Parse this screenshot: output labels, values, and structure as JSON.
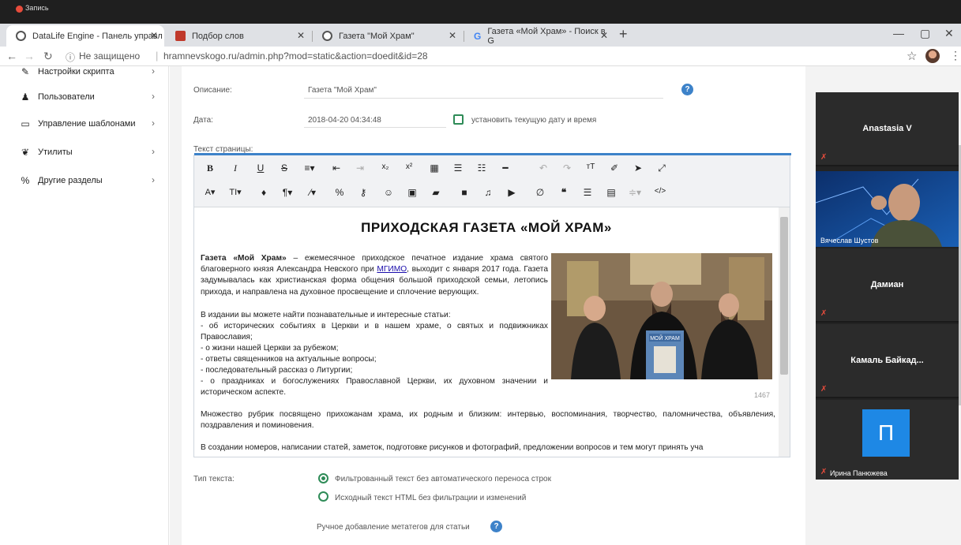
{
  "recorder": {
    "label": "Запись"
  },
  "browser": {
    "tabs": [
      {
        "title": "DataLife Engine - Панель управл",
        "active": true
      },
      {
        "title": "Подбор слов",
        "active": false
      },
      {
        "title": "Газета \"Мой Храм\"",
        "active": false
      },
      {
        "title": "Газета «Мой Храм» - Поиск в G",
        "active": false
      }
    ],
    "new_tab": "+",
    "address": {
      "security": "Не защищено",
      "url": "hramnevskogo.ru/admin.php?mod=static&action=doedit&id=28"
    }
  },
  "sidebar": {
    "items": [
      {
        "label": "Настройки скрипта",
        "icon": "wrench-icon"
      },
      {
        "label": "Пользователи",
        "icon": "user-icon"
      },
      {
        "label": "Управление шаблонами",
        "icon": "monitor-icon"
      },
      {
        "label": "Утилиты",
        "icon": "leaf-icon"
      },
      {
        "label": "Другие разделы",
        "icon": "link-icon"
      }
    ]
  },
  "form": {
    "description_label": "Описание:",
    "description_value": "Газета \"Мой Храм\"",
    "date_label": "Дата:",
    "date_value": "2018-04-20 04:34:48",
    "set_current_label": "установить текущую дату и время",
    "page_text_label": "Текст страницы:",
    "text_type_label": "Тип текста:",
    "text_type_options": [
      {
        "label": "Фильтрованный текст без автоматического переноса строк",
        "checked": true
      },
      {
        "label": "Исходный текст HTML без фильтрации и изменений",
        "checked": false
      }
    ],
    "meta_label": "Ручное добавление метатегов для статьи"
  },
  "editor": {
    "title": "ПРИХОДСКАЯ ГАЗЕТА «МОЙ ХРАМ»",
    "intro_bold": "Газета «Мой Храм»",
    "intro_rest_1": " – ежемесячное приходское печатное издание храма святого благоверного князя Александра Невского при ",
    "intro_link": "МГИМО",
    "intro_rest_2": ", выходит с января 2017 года. Газета задумывалась как христианская форма общения большой приходской семьи, летопись прихода, и направлена на духовное просвещение и сплочение верующих.",
    "list_intro": "В издании вы можете найти познавательные и интересные статьи:",
    "list_items": [
      "- об исторических событиях в Церкви и в нашем храме, о святых и подвижниках Православия;",
      "- о жизни нашей Церкви за рубежом;",
      "- ответы священников на актуальные вопросы;",
      "- последовательный рассказ о Литургии;",
      "- о праздниках и богослужениях Православной Церкви, их духовном значении и историческом аспекте."
    ],
    "rubrics": "Множество рубрик посвящено прихожанам храма, их родным и близким: интервью, воспоминания, творчество, паломничества, объявления, поздравления и поминовения.",
    "creation": "В создании номеров, написании статей, заметок, подготовке рисунков и фотографий, предложении вопросов и тем могут принять уча",
    "char_count": "1467",
    "photo_magazine_text": "МОЙ ХРАМ"
  },
  "conference": {
    "participants": [
      {
        "name": "Anastasia V"
      },
      {
        "name": "Вячеслав Шустов"
      },
      {
        "name": "Дамиан"
      },
      {
        "name": "Камаль  Байкад..."
      },
      {
        "name": "Ирина Панюжева",
        "avatar_letter": "П"
      }
    ]
  },
  "colors": {
    "accent": "#3d82c9",
    "green": "#2e8b57",
    "conference_bg": "#2b2b2b",
    "avatar_blue": "#1e88e5"
  }
}
